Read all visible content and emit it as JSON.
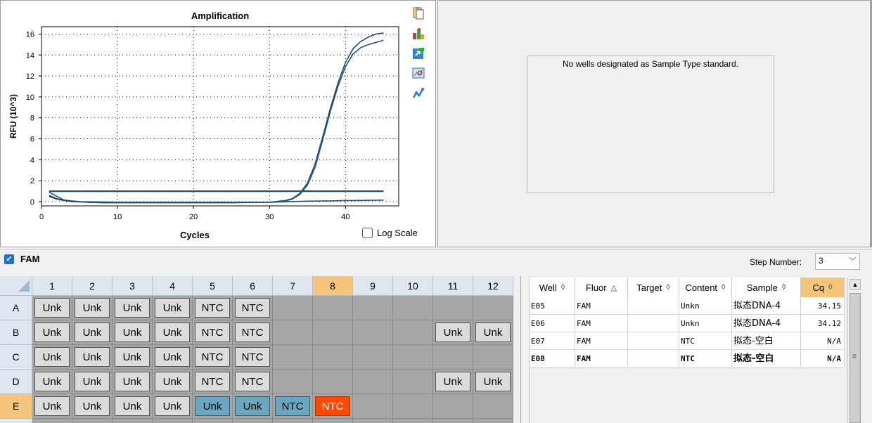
{
  "chart": {
    "toolbar_icons": [
      "copy-icon",
      "color-settings-icon",
      "export-icon",
      "zoom-chart-icon",
      "trace-style-icon"
    ],
    "log_scale_label": "Log Scale",
    "log_scale_checked": false
  },
  "chart_data": {
    "type": "line",
    "title": "Amplification",
    "xlabel": "Cycles",
    "ylabel": "RFU (10^3)",
    "xlim": [
      0,
      47
    ],
    "ylim": [
      -0.4,
      16.7
    ],
    "xticks": [
      0,
      10,
      20,
      30,
      40
    ],
    "yticks": [
      0,
      2,
      4,
      6,
      8,
      10,
      12,
      14,
      16
    ],
    "grid": true,
    "threshold": 1.0,
    "series": [
      {
        "x": [
          1,
          2,
          3,
          4,
          6,
          8,
          10,
          15,
          20,
          25,
          30,
          32,
          33,
          34,
          35,
          36,
          37,
          38,
          39,
          40,
          41,
          42,
          43,
          44,
          45
        ],
        "y": [
          0.6,
          0.3,
          0.15,
          0.05,
          -0.05,
          -0.1,
          -0.1,
          -0.1,
          -0.1,
          -0.1,
          -0.05,
          0.1,
          0.3,
          0.8,
          1.8,
          3.6,
          6.2,
          8.9,
          11.3,
          13.3,
          14.6,
          15.3,
          15.7,
          16.0,
          16.1
        ]
      },
      {
        "x": [
          1,
          2,
          3,
          4,
          6,
          8,
          10,
          15,
          20,
          25,
          30,
          32,
          33,
          34,
          35,
          36,
          37,
          38,
          39,
          40,
          41,
          42,
          43,
          44,
          45
        ],
        "y": [
          0.5,
          0.25,
          0.1,
          0.0,
          -0.05,
          -0.1,
          -0.1,
          -0.1,
          -0.1,
          -0.1,
          -0.05,
          0.05,
          0.25,
          0.7,
          1.6,
          3.3,
          5.9,
          8.6,
          11.0,
          12.9,
          14.1,
          14.7,
          15.0,
          15.2,
          15.4
        ]
      },
      {
        "x": [
          1,
          3,
          5,
          10,
          20,
          30,
          35,
          40,
          45
        ],
        "y": [
          0.9,
          0.15,
          0.0,
          -0.05,
          -0.05,
          -0.05,
          0.05,
          0.1,
          0.15
        ]
      }
    ]
  },
  "standard": {
    "message": "No wells designated as Sample Type standard."
  },
  "fluor_bar": {
    "label": "FAM",
    "checked": true,
    "step_label": "Step Number:",
    "step_value": "3"
  },
  "plate": {
    "columns": [
      "1",
      "2",
      "3",
      "4",
      "5",
      "6",
      "7",
      "8",
      "9",
      "10",
      "11",
      "12"
    ],
    "rows": [
      "A",
      "B",
      "C",
      "D",
      "E"
    ],
    "selected_column": 7,
    "selected_row": 4,
    "wells": [
      [
        "Unk",
        "Unk",
        "Unk",
        "Unk",
        "NTC",
        "NTC",
        "",
        "",
        "",
        "",
        "",
        ""
      ],
      [
        "Unk",
        "Unk",
        "Unk",
        "Unk",
        "NTC",
        "NTC",
        "",
        "",
        "",
        "",
        "Unk",
        "Unk"
      ],
      [
        "Unk",
        "Unk",
        "Unk",
        "Unk",
        "NTC",
        "NTC",
        "",
        "",
        "",
        "",
        "",
        ""
      ],
      [
        "Unk",
        "Unk",
        "Unk",
        "Unk",
        "NTC",
        "NTC",
        "",
        "",
        "",
        "",
        "Unk",
        "Unk"
      ],
      [
        "Unk",
        "Unk",
        "Unk",
        "Unk",
        "Unk",
        "Unk",
        "NTC",
        "NTC",
        "",
        "",
        "",
        ""
      ]
    ],
    "highlight_teal": [
      [
        4,
        4
      ],
      [
        4,
        5
      ],
      [
        4,
        6
      ]
    ],
    "highlight_orange": [
      [
        4,
        7
      ]
    ]
  },
  "table": {
    "headers": [
      "Well",
      "Fluor",
      "Target",
      "Content",
      "Sample",
      "Cq"
    ],
    "sort_icons": [
      "◊",
      "△",
      "◊",
      "◊",
      "◊",
      "◊"
    ],
    "rows": [
      [
        "E05",
        "FAM",
        "",
        "Unkn",
        "拟态DNA-4",
        "34.15"
      ],
      [
        "E06",
        "FAM",
        "",
        "Unkn",
        "拟态DNA-4",
        "34.12"
      ],
      [
        "E07",
        "FAM",
        "",
        "NTC",
        "拟态-空白",
        "N/A"
      ],
      [
        "E08",
        "FAM",
        "",
        "NTC",
        "拟态-空白",
        "N/A"
      ]
    ],
    "bold_row": 3
  }
}
